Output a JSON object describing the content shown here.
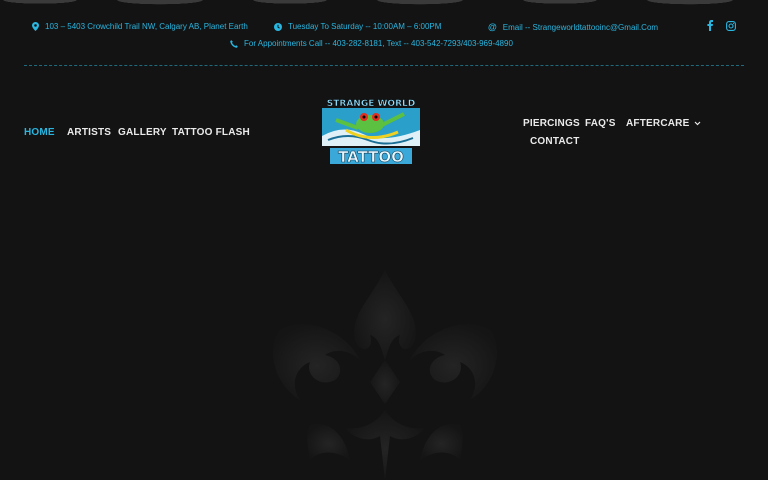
{
  "topbar": {
    "address": "103 – 5403 Crowchild Trail NW, Calgary AB, Planet Earth",
    "hours": "Tuesday To Saturday -- 10:00AM – 6:00PM",
    "email": "Email -- Strangeworldtattooinc@Gmail.Com",
    "phone": "For Appointments Call -- 403-282-8181, Text -- 403-542-7293/403-969-4890",
    "social": [
      "facebook-icon",
      "instagram-icon"
    ]
  },
  "nav": {
    "left": [
      {
        "label": "HOME",
        "active": true
      },
      {
        "label": "ARTISTS",
        "active": false
      },
      {
        "label": "GALLERY",
        "active": false
      },
      {
        "label": "TATTOO FLASH",
        "active": false
      }
    ],
    "right": [
      {
        "label": "PIERCINGS"
      },
      {
        "label": "FAQ'S"
      },
      {
        "label": "AFTERCARE"
      },
      {
        "label": "CONTACT"
      }
    ]
  },
  "logo": {
    "line1": "STRANGE WORLD",
    "line2": "TATTOO"
  },
  "colors": {
    "accent": "#29b6e0",
    "background": "#131313",
    "nav_text": "#eaeaea"
  }
}
